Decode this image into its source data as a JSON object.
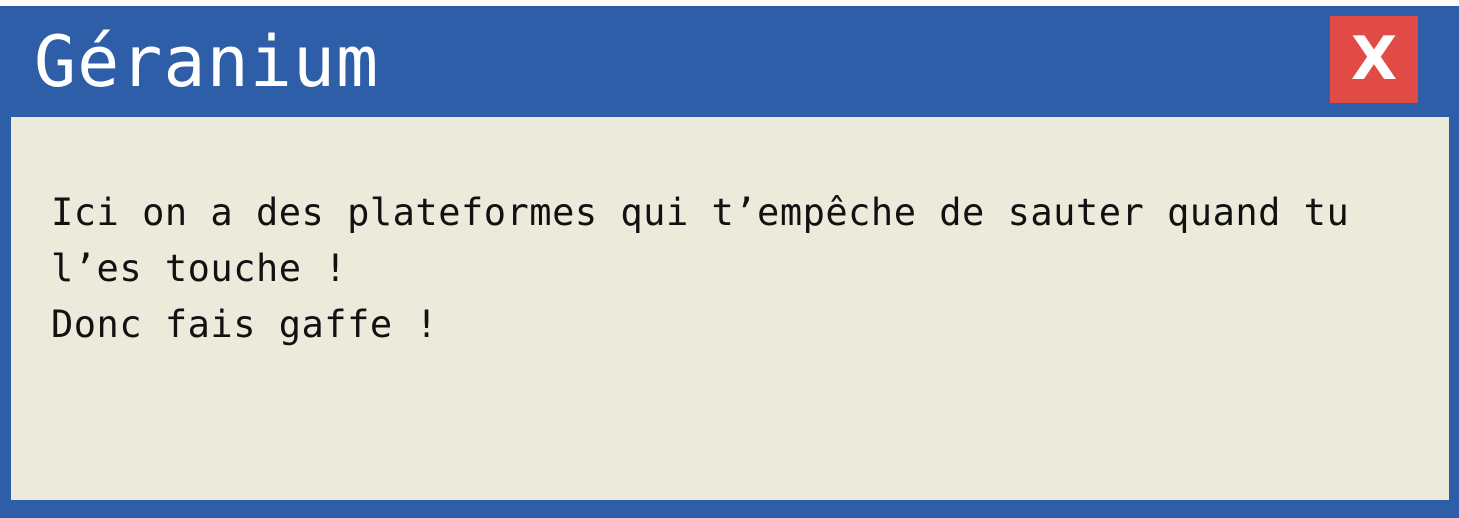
{
  "dialog": {
    "title": "Géranium",
    "close_label": "X",
    "message_lines": [
      "Ici on a des plateformes qui t’empêche de sauter quand tu",
      "l’es touche !",
      "Donc fais gaffe !"
    ]
  },
  "colors": {
    "frame": "#2f5ea8",
    "close_button": "#e14b46",
    "content_background": "#eceada",
    "title_text": "#ffffff",
    "message_text": "#111111"
  }
}
